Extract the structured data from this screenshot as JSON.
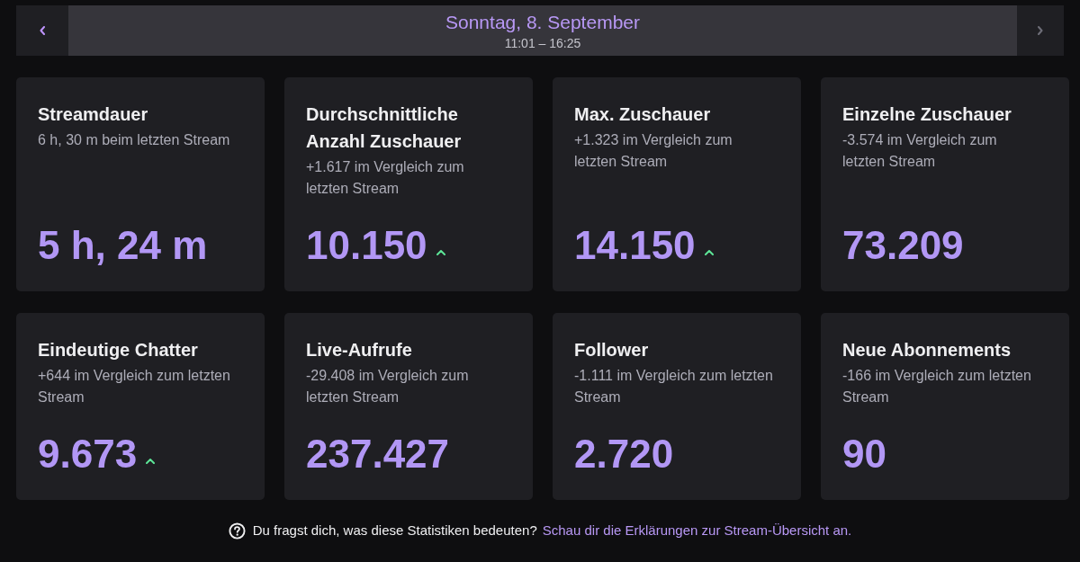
{
  "date_nav": {
    "previous": {
      "disabled": false
    },
    "date": "Sonntag, 8. September",
    "time_range": "11:01 – 16:25",
    "next": {
      "disabled": true
    }
  },
  "cards": [
    {
      "title": "Streamdauer",
      "comparison": "6 h, 30 m beim letzten Stream",
      "value": "5 h, 24 m",
      "trend_up": false
    },
    {
      "title": "Durchschnittliche Anzahl Zuschauer",
      "comparison": "+1.617 im Vergleich zum letzten Stream",
      "value": "10.150",
      "trend_up": true
    },
    {
      "title": "Max. Zuschauer",
      "comparison": "+1.323 im Vergleich zum letzten Stream",
      "value": "14.150",
      "trend_up": true
    },
    {
      "title": "Einzelne Zuschauer",
      "comparison": "-3.574 im Vergleich zum letzten Stream",
      "value": "73.209",
      "trend_up": false
    },
    {
      "title": "Eindeutige Chatter",
      "comparison": "+644 im Vergleich zum letzten Stream",
      "value": "9.673",
      "trend_up": true
    },
    {
      "title": "Live-Aufrufe",
      "comparison": "-29.408 im Vergleich zum letzten Stream",
      "value": "237.427",
      "trend_up": false
    },
    {
      "title": "Follower",
      "comparison": "-1.111 im Vergleich zum letzten Stream",
      "value": "2.720",
      "trend_up": false
    },
    {
      "title": "Neue Abonnements",
      "comparison": "-166 im Vergleich zum letzten Stream",
      "value": "90",
      "trend_up": false
    }
  ],
  "footer": {
    "question": "Du fragst dich, was diese Statistiken bedeuten?",
    "link": "Schau dir die Erklärungen zur Stream-Übersicht an."
  }
}
